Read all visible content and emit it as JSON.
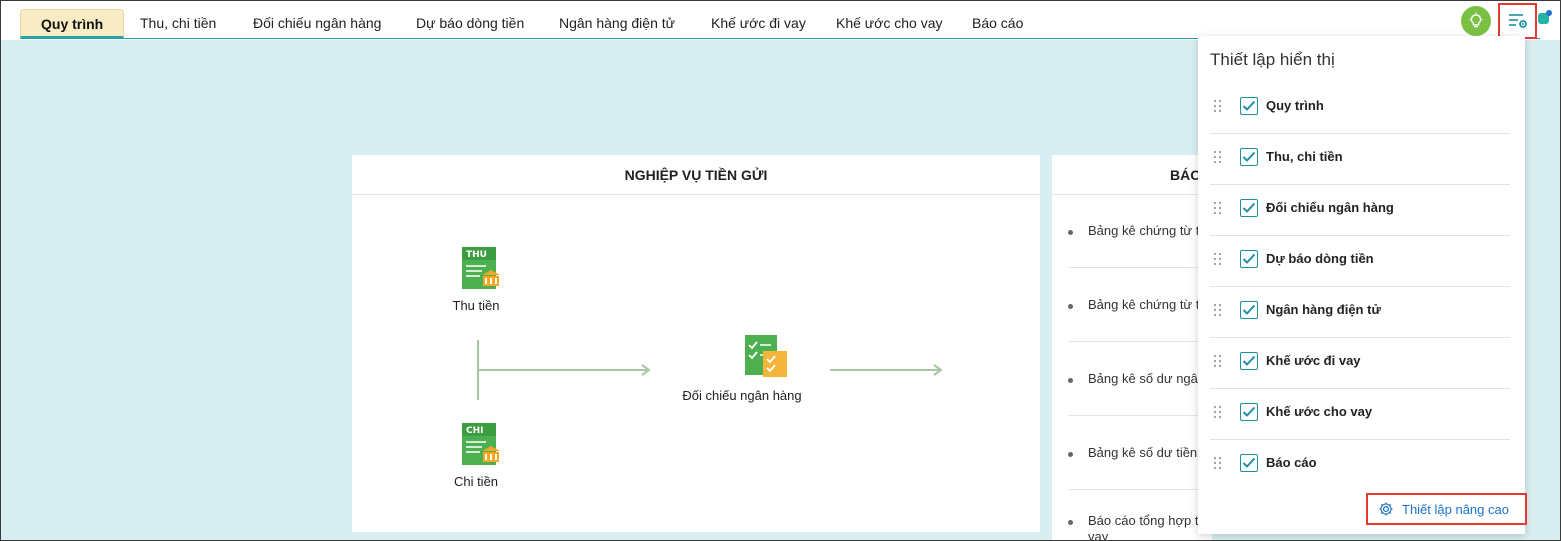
{
  "tabs": [
    {
      "label": "Quy trình",
      "active": true
    },
    {
      "label": "Thu, chi tiền",
      "active": false
    },
    {
      "label": "Đối chiếu ngân hàng",
      "active": false
    },
    {
      "label": "Dự báo dòng tiền",
      "active": false
    },
    {
      "label": "Ngân hàng điện tử",
      "active": false
    },
    {
      "label": "Khế ước đi vay",
      "active": false
    },
    {
      "label": "Khế ước cho vay",
      "active": false
    },
    {
      "label": "Báo cáo",
      "active": false
    }
  ],
  "toolbar": {
    "tips_icon": "lightbulb-icon",
    "settings_icon": "display-settings-icon"
  },
  "deposit_card": {
    "title": "NGHIỆP VỤ TIỀN GỬI",
    "nodes": {
      "receive": {
        "badge": "THU",
        "label": "Thu tiền"
      },
      "pay": {
        "badge": "CHI",
        "label": "Chi tiền"
      },
      "reconcile": {
        "label": "Đối chiếu ngân hàng"
      }
    }
  },
  "report_card": {
    "title": "BÁO",
    "items": [
      "Bảng kê chứng từ t",
      "Bảng kê chứng từ t",
      "Bảng kê số dư ngâ",
      "Bảng kê số dư tiền",
      "Báo cáo tổng hợp t"
    ],
    "overflow_text": "vay"
  },
  "display_settings": {
    "title": "Thiết lập hiển thị",
    "options": [
      {
        "label": "Quy trình",
        "checked": true
      },
      {
        "label": "Thu, chi tiền",
        "checked": true
      },
      {
        "label": "Đối chiếu ngân hàng",
        "checked": true
      },
      {
        "label": "Dự báo dòng tiền",
        "checked": true
      },
      {
        "label": "Ngân hàng điện tử",
        "checked": true
      },
      {
        "label": "Khế ước đi vay",
        "checked": true
      },
      {
        "label": "Khế ước cho vay",
        "checked": true
      },
      {
        "label": "Báo cáo",
        "checked": true
      }
    ],
    "advanced_label": "Thiết lập nâng cao"
  },
  "colors": {
    "accent": "#2aa1a8",
    "active_tab": "#f7ecc4",
    "highlight_border": "#e53935",
    "link": "#1a73c8",
    "background": "#d9eef0"
  }
}
